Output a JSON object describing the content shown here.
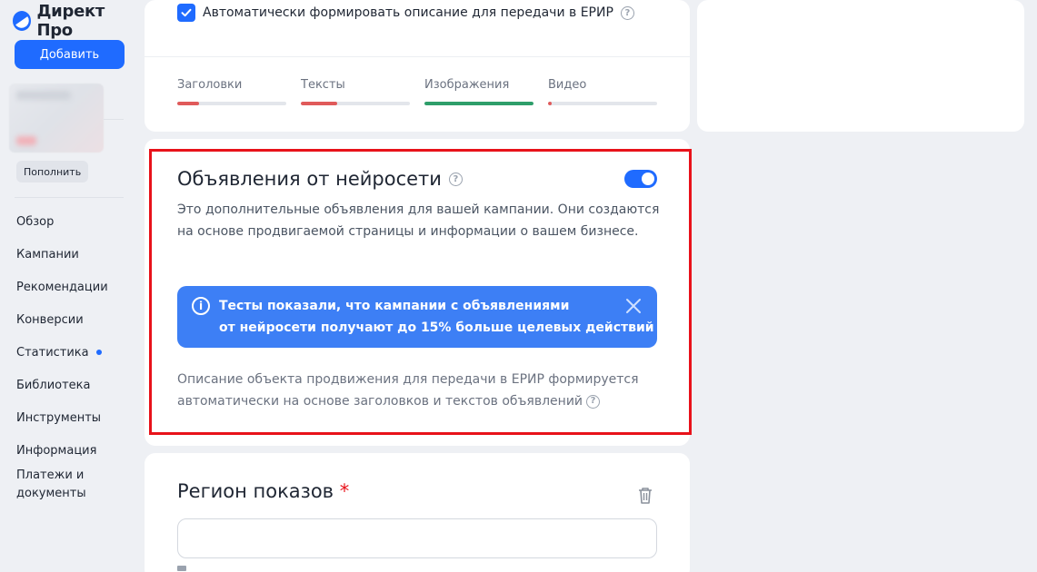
{
  "sidebar": {
    "logo_text": "Директ Про",
    "add_button": "Добавить",
    "topup_button": "Пополнить",
    "nav": [
      {
        "label": "Обзор",
        "dot": false
      },
      {
        "label": "Кампании",
        "dot": false
      },
      {
        "label": "Рекомендации",
        "dot": false
      },
      {
        "label": "Конверсии",
        "dot": false
      },
      {
        "label": "Статистика",
        "dot": true
      },
      {
        "label": "Библиотека",
        "dot": false
      },
      {
        "label": "Инструменты",
        "dot": false
      },
      {
        "label": "Информация",
        "dot": false
      },
      {
        "label": "Платежи и документы",
        "dot": false
      }
    ]
  },
  "top_card": {
    "checkbox_label": "Автоматически формировать описание для передачи в ЕРИР",
    "checkbox_checked": true,
    "progress": [
      {
        "label": "Заголовки",
        "value": 0.2,
        "color": "#e05a5a"
      },
      {
        "label": "Тексты",
        "value": 0.33,
        "color": "#e05a5a"
      },
      {
        "label": "Изображения",
        "value": 1.0,
        "color": "#2e9e6a"
      },
      {
        "label": "Видео",
        "value": 0.03,
        "color": "#e05a5a"
      }
    ]
  },
  "neuro": {
    "title": "Объявления от нейросети",
    "toggle_on": true,
    "description": "Это дополнительные объявления для вашей кампании. Они создаются на основе продвигаемой страницы и информации о вашем бизнесе.",
    "banner_line1": "Тесты показали, что кампании с объявлениями",
    "banner_line2": "от нейросети получают до 15% больше целевых действий",
    "footer": "Описание объекта продвижения для передачи в ЕРИР формируется автоматически на основе заголовков и текстов объявлений"
  },
  "region": {
    "title": "Регион показов",
    "required_mark": "*",
    "input_value": ""
  },
  "colors": {
    "accent": "#1f6bff",
    "banner": "#3d7ff5",
    "highlight_border": "#e8121a"
  }
}
